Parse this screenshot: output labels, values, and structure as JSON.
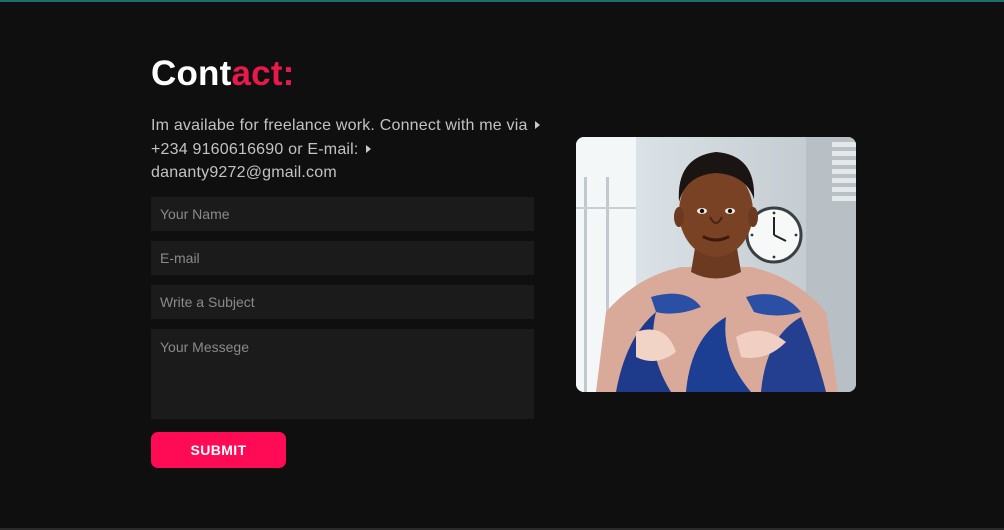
{
  "contact": {
    "title_main": "Cont",
    "title_accent": "act:",
    "intro_line1": "Im availabe for freelance work. Connect with me via",
    "intro_line2": "+234 9160616690 or E-mail:",
    "intro_line3": "dananty9272@gmail.com"
  },
  "form": {
    "name_placeholder": "Your Name",
    "email_placeholder": "E-mail",
    "subject_placeholder": "Write a Subject",
    "message_placeholder": "Your Messege",
    "submit_label": "SUBMIT"
  },
  "colors": {
    "background": "#0f0f10",
    "accent": "#e8194b",
    "button": "#ff0a54",
    "input_bg": "#1b1b1c"
  },
  "icons": [
    "arrow-right-icon"
  ]
}
